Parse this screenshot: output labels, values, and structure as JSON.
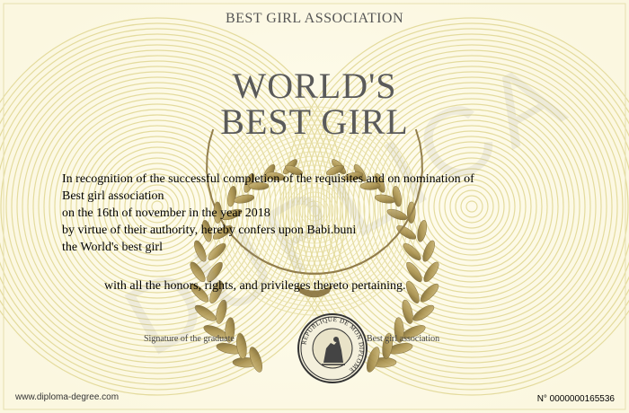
{
  "certificate": {
    "organization": "BEST GIRL ASSOCIATION",
    "title_line1": "WORLD'S",
    "title_line2": "BEST GIRL",
    "body_lines": [
      "In recognition of the successful completion of the requisites and on nomination of",
      "Best girl association",
      "on the 16th of november in the year 2018",
      "by virtue of their authority, hereby confers upon Babi.buni",
      "the World's best girl"
    ],
    "honors_line": "with all the honors, rights, and privileges thereto pertaining.",
    "signature_left_label": "Signature of the graduate",
    "signature_right_label": "Best girl association",
    "seal_text": "REPUBLIQUE DE MON DIPLOME",
    "website": "www.diploma-degree.com",
    "serial_number": "N° 0000000165536",
    "watermark": "DUPLICA"
  },
  "colors": {
    "guilloche_line": "#e3da9a",
    "laurel_gold": "#a8904d",
    "title_gray": "#5a5a5a"
  },
  "icons": {
    "seal": "seal-icon",
    "wreath": "laurel-wreath-icon"
  }
}
